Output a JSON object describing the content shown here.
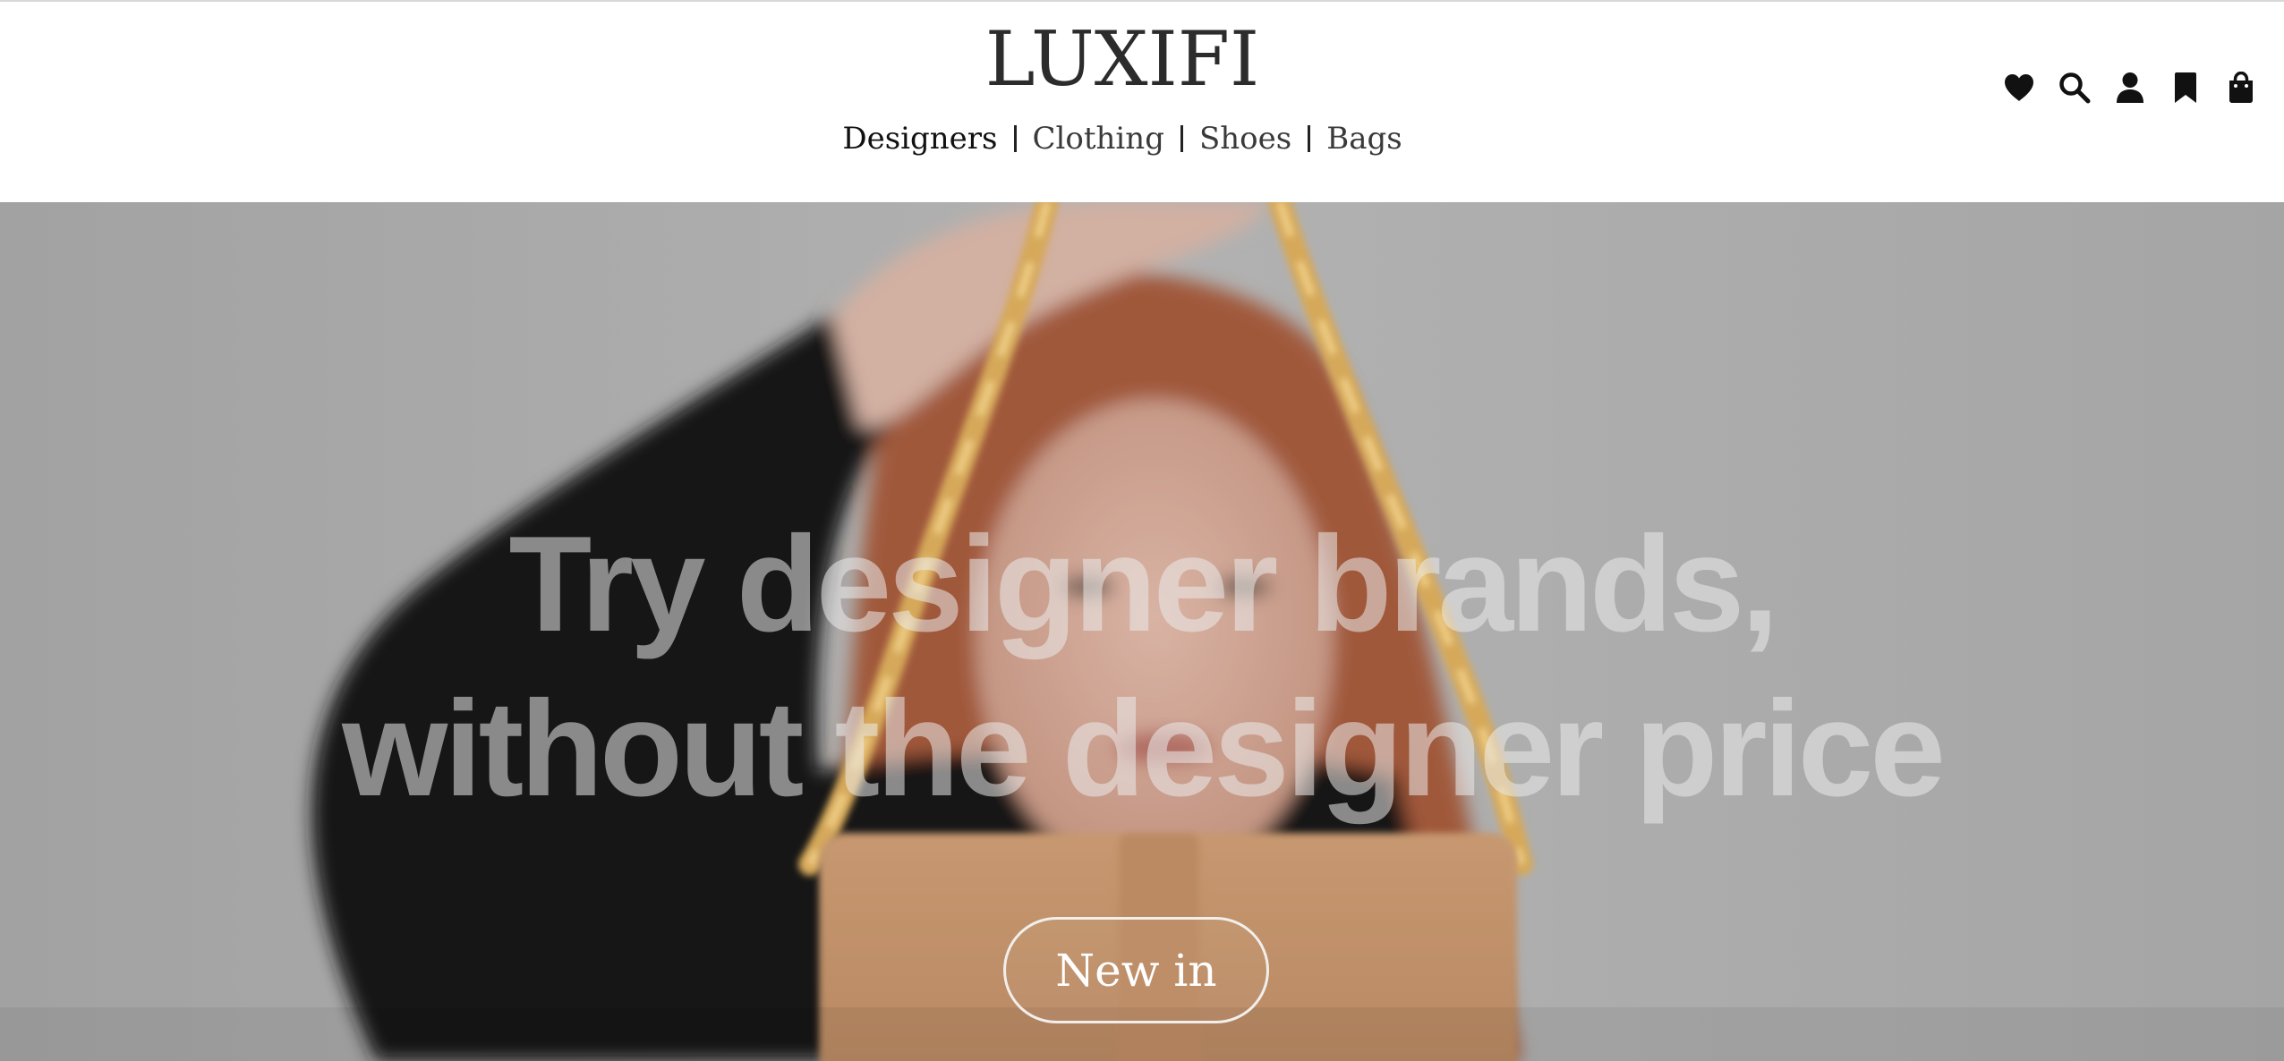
{
  "brand": {
    "logo_text": "LUXIFI"
  },
  "nav": {
    "items": [
      {
        "label": "Designers",
        "active": true
      },
      {
        "label": "Clothing",
        "active": false
      },
      {
        "label": "Shoes",
        "active": false
      },
      {
        "label": "Bags",
        "active": false
      }
    ]
  },
  "header_icons": [
    "heart-icon",
    "search-icon",
    "user-icon",
    "bookmark-icon",
    "shopping-bag-icon"
  ],
  "hero": {
    "headline_line1": "Try designer brands,",
    "headline_line2": "without the designer price",
    "cta_label": "New in"
  },
  "colors": {
    "header_bg": "#ffffff",
    "text_dark": "#2c2c2c",
    "hero_bg": "#a9a9a9",
    "cta_border": "#f1efec"
  }
}
